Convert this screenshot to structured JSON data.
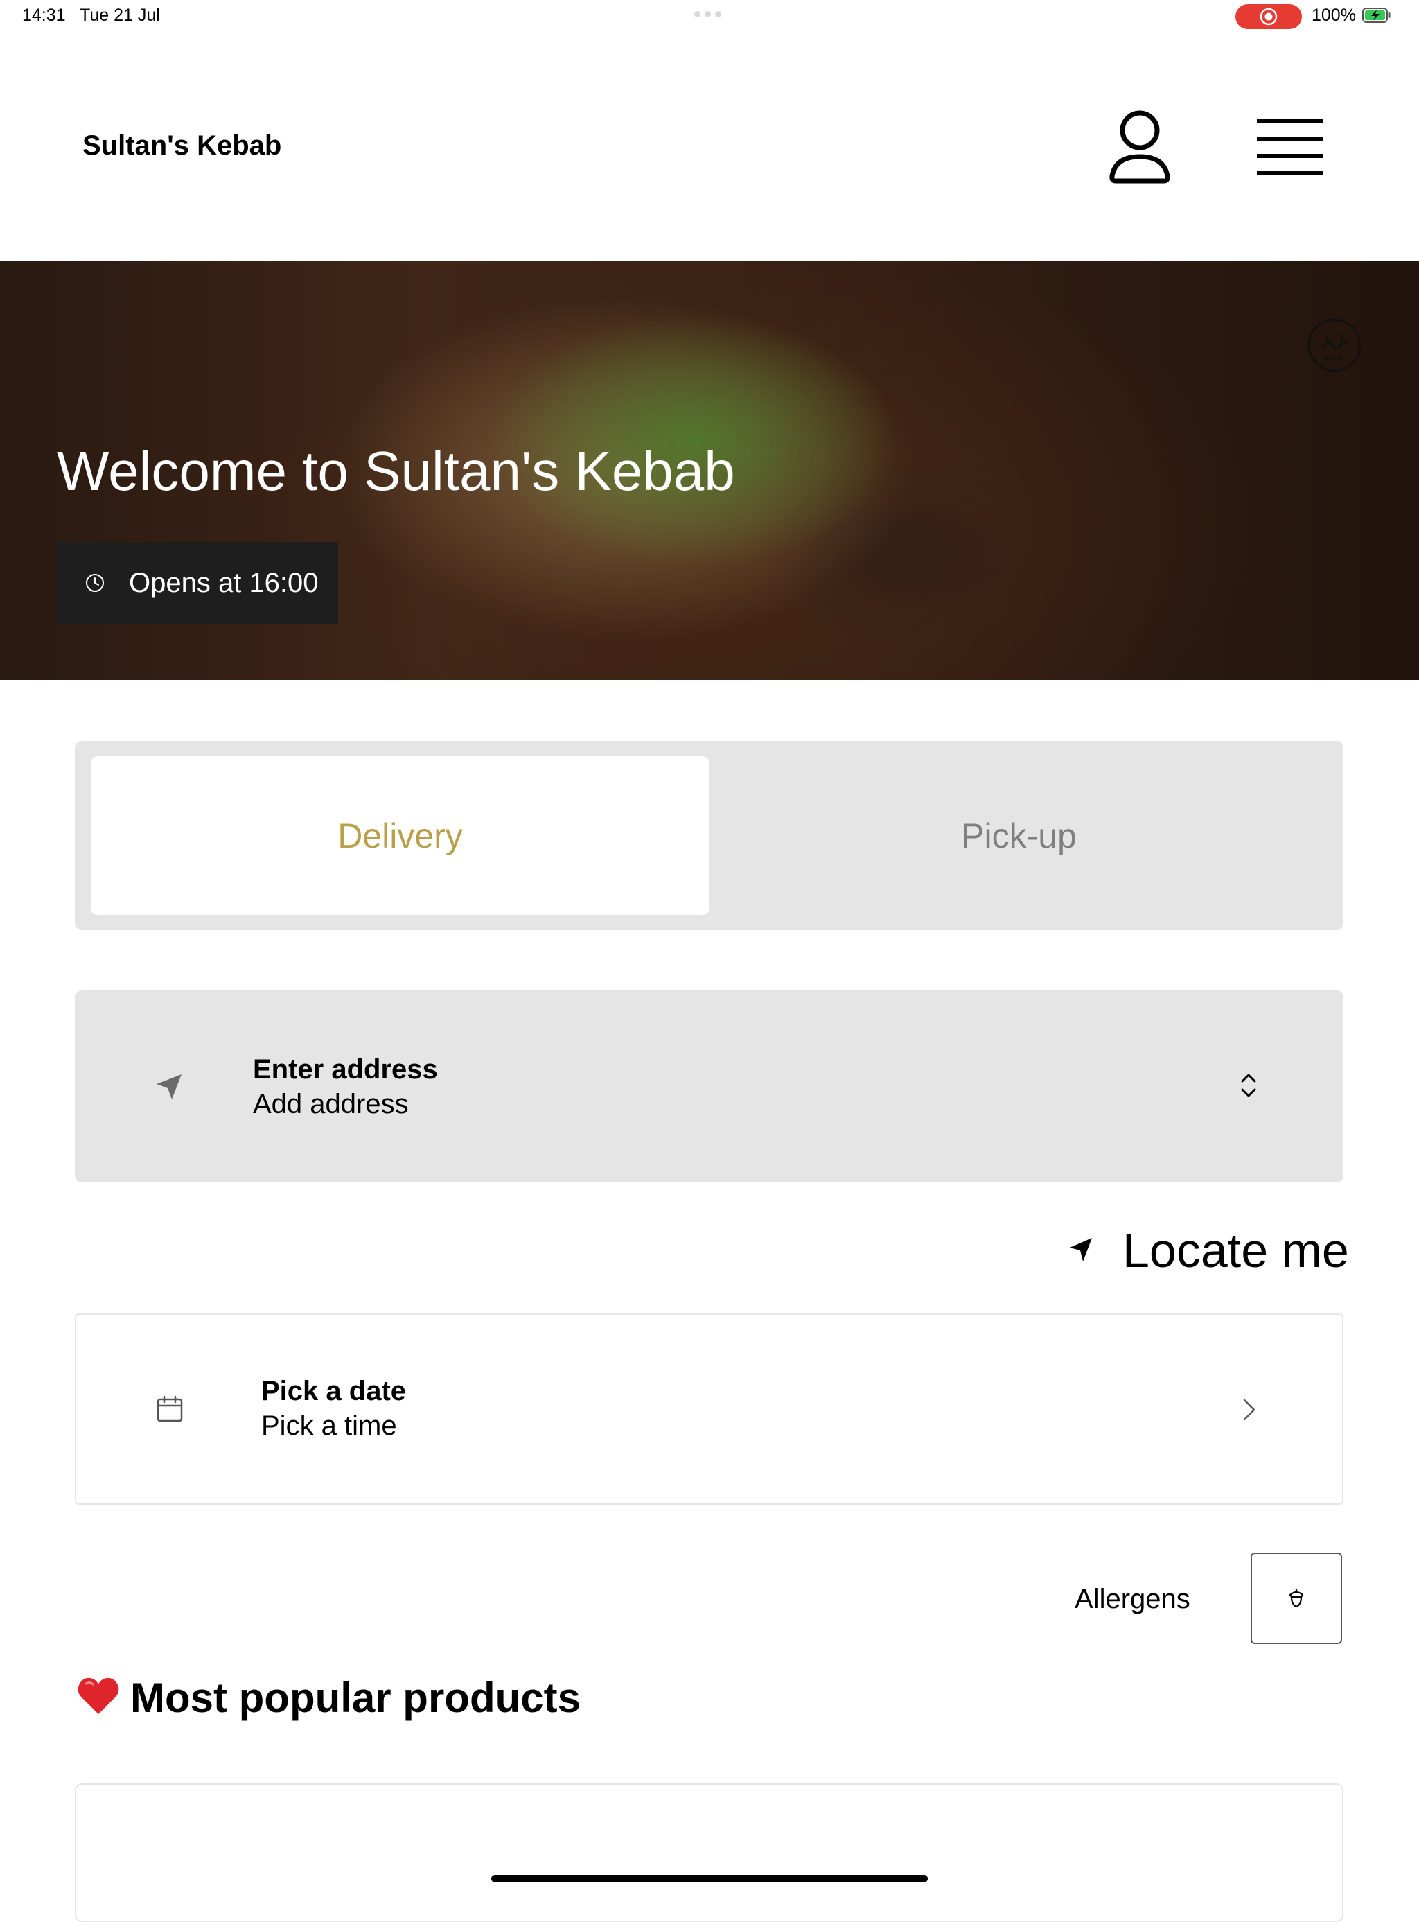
{
  "status_bar": {
    "time": "14:31",
    "date": "Tue 21 Jul",
    "battery": "100%",
    "recording_color": "#e63b32"
  },
  "header": {
    "brand": "Sultan's Kebab",
    "icons": [
      "user-icon",
      "hamburger-menu-icon"
    ]
  },
  "hero": {
    "title": "Welcome to Sultan's Kebab",
    "badge": "Opens at 16:00",
    "halal_icon": "halal-icon"
  },
  "order_mode": {
    "tabs": [
      {
        "label": "Delivery",
        "active": true
      },
      {
        "label": "Pick-up",
        "active": false
      }
    ],
    "accent_color": "#b9a04a"
  },
  "address": {
    "title": "Enter address",
    "subtitle": "Add address",
    "icon": "location-arrow-icon"
  },
  "locate": {
    "label": "Locate me",
    "icon": "navigation-arrow-icon"
  },
  "schedule": {
    "title": "Pick a date",
    "subtitle": "Pick a time",
    "icon": "calendar-icon"
  },
  "allergens": {
    "label": "Allergens",
    "icon": "acorn-icon"
  },
  "popular": {
    "emoji": "❤️",
    "title": "Most popular products"
  }
}
